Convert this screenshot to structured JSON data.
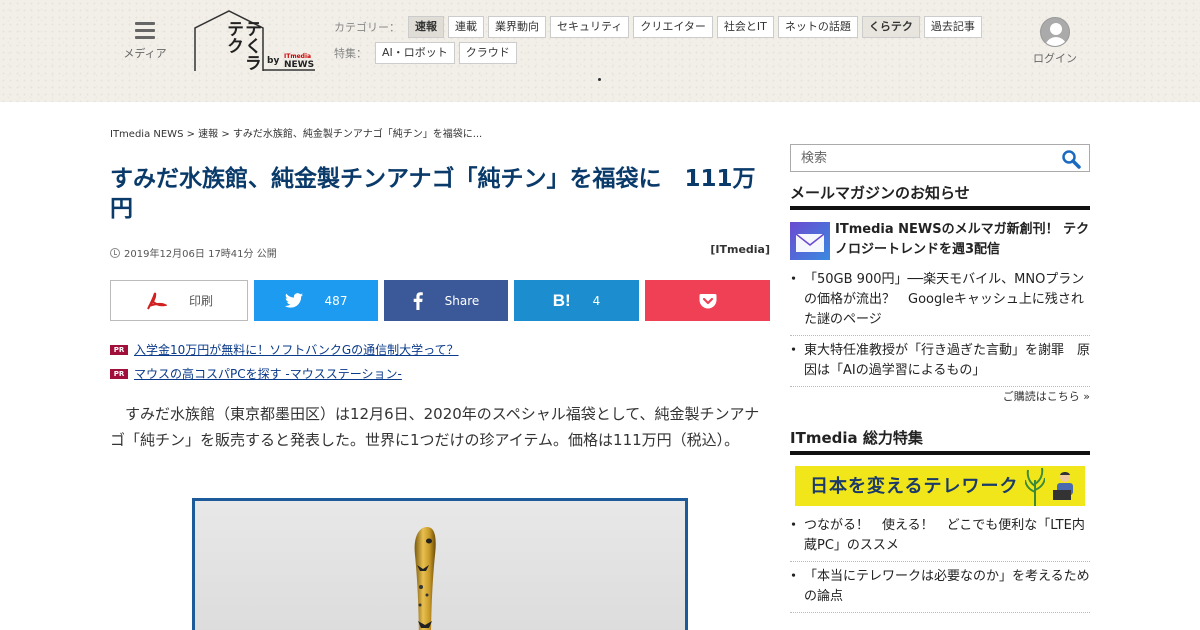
{
  "header": {
    "menu_label": "メディア",
    "logo_text": "テくラテク",
    "logo_by": "by",
    "logo_itmedia": "ITmedia",
    "logo_news": "NEWS",
    "category_label": "カテゴリー：",
    "categories": [
      "速報",
      "連載",
      "業界動向",
      "セキュリティ",
      "クリエイター",
      "社会とIT",
      "ネットの話題",
      "くらテク",
      "過去記事"
    ],
    "feature_label": "特集：",
    "features": [
      "AI・ロボット",
      "クラウド"
    ],
    "login_label": "ログイン"
  },
  "article": {
    "breadcrumb": "ITmedia NEWS > 速報 > すみだ水族館、純金製チンアナゴ「純チン」を福袋に...",
    "title": "すみだ水族館、純金製チンアナゴ「純チン」を福袋に　111万円",
    "date": "2019年12月06日 17時41分 公開",
    "source": "[ITmedia]",
    "share": {
      "print": "印刷",
      "twitter_count": "487",
      "facebook_label": "Share",
      "hatena_count": "4"
    },
    "pr_badge": "PR",
    "pr_links": [
      "入学金10万円が無料に！ソフトバンクGの通信制大学って？",
      "マウスの高コスパPCを探す -マウスステーション-"
    ],
    "body": "すみだ水族館（東京都墨田区）は12月6日、2020年のスペシャル福袋として、純金製チンアナゴ「純チン」を販売すると発表した。世界に1つだけの珍アイテム。価格は111万円（税込）。"
  },
  "sidebar": {
    "search_placeholder": "検索",
    "newsletter_heading": "メールマガジンのお知らせ",
    "newsletter_feature": "ITmedia NEWSのメルマガ新創刊！ テクノロジートレンドを週3配信",
    "newsletter_items": [
      "「50GB 900円」──楽天モバイル、MNOプランの価格が流出？　Googleキャッシュ上に残された謎のページ",
      "東大特任准教授が「行き過ぎた言動」を謝罪　原因は「AIの過学習によるもの」"
    ],
    "subscribe_link": "ご購読はこちら »",
    "feature_heading": "ITmedia 総力特集",
    "telework_banner": "日本を変えるテレワーク",
    "feature_items": [
      "つながる！　使える！　どこでも便利な「LTE内蔵PC」のススメ",
      "「本当にテレワークは必要なのか」を考えるための論点"
    ]
  },
  "colors": {
    "title": "#0a3a6a",
    "twitter": "#1d9bf0",
    "facebook": "#3b5998",
    "hatena": "#1c8ecf",
    "pocket": "#ef4056",
    "pr": "#a0103a",
    "banner": "#f1e61a"
  }
}
